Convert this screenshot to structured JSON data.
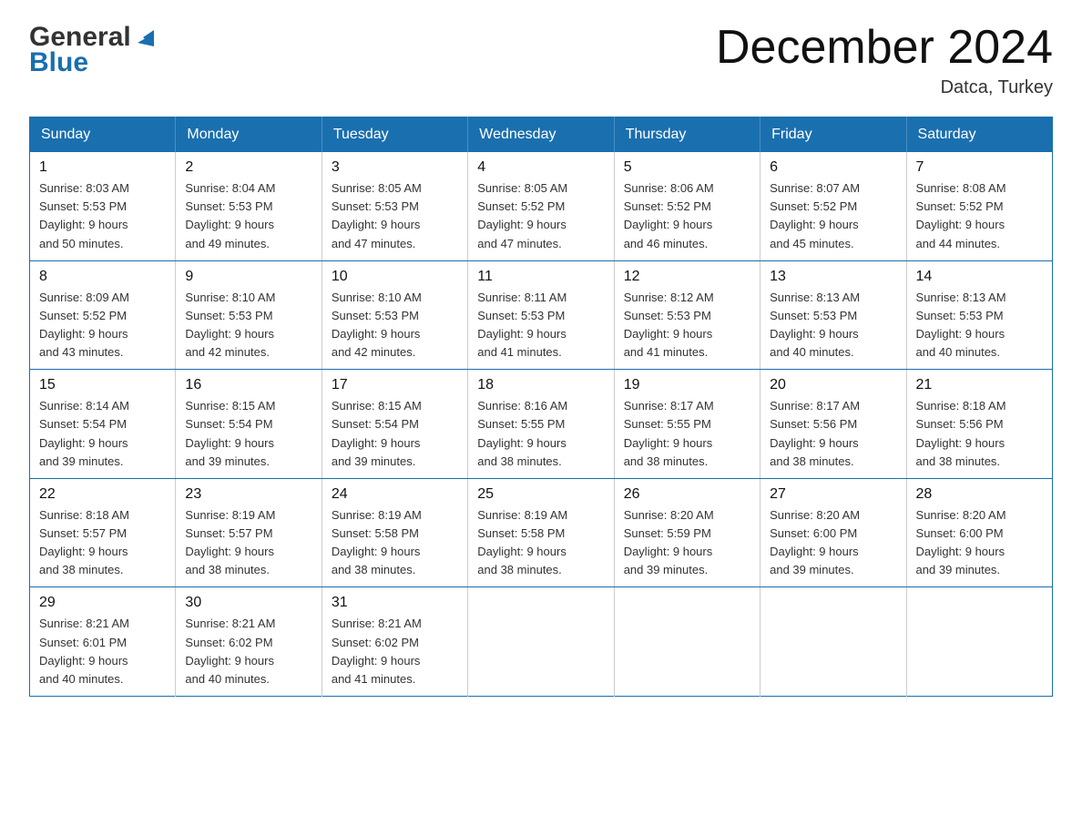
{
  "header": {
    "logo_general": "General",
    "logo_blue": "Blue",
    "title": "December 2024",
    "location": "Datca, Turkey"
  },
  "days_header": [
    "Sunday",
    "Monday",
    "Tuesday",
    "Wednesday",
    "Thursday",
    "Friday",
    "Saturday"
  ],
  "weeks": [
    [
      {
        "day": "1",
        "sunrise": "8:03 AM",
        "sunset": "5:53 PM",
        "daylight": "9 hours and 50 minutes."
      },
      {
        "day": "2",
        "sunrise": "8:04 AM",
        "sunset": "5:53 PM",
        "daylight": "9 hours and 49 minutes."
      },
      {
        "day": "3",
        "sunrise": "8:05 AM",
        "sunset": "5:53 PM",
        "daylight": "9 hours and 47 minutes."
      },
      {
        "day": "4",
        "sunrise": "8:05 AM",
        "sunset": "5:52 PM",
        "daylight": "9 hours and 47 minutes."
      },
      {
        "day": "5",
        "sunrise": "8:06 AM",
        "sunset": "5:52 PM",
        "daylight": "9 hours and 46 minutes."
      },
      {
        "day": "6",
        "sunrise": "8:07 AM",
        "sunset": "5:52 PM",
        "daylight": "9 hours and 45 minutes."
      },
      {
        "day": "7",
        "sunrise": "8:08 AM",
        "sunset": "5:52 PM",
        "daylight": "9 hours and 44 minutes."
      }
    ],
    [
      {
        "day": "8",
        "sunrise": "8:09 AM",
        "sunset": "5:52 PM",
        "daylight": "9 hours and 43 minutes."
      },
      {
        "day": "9",
        "sunrise": "8:10 AM",
        "sunset": "5:53 PM",
        "daylight": "9 hours and 42 minutes."
      },
      {
        "day": "10",
        "sunrise": "8:10 AM",
        "sunset": "5:53 PM",
        "daylight": "9 hours and 42 minutes."
      },
      {
        "day": "11",
        "sunrise": "8:11 AM",
        "sunset": "5:53 PM",
        "daylight": "9 hours and 41 minutes."
      },
      {
        "day": "12",
        "sunrise": "8:12 AM",
        "sunset": "5:53 PM",
        "daylight": "9 hours and 41 minutes."
      },
      {
        "day": "13",
        "sunrise": "8:13 AM",
        "sunset": "5:53 PM",
        "daylight": "9 hours and 40 minutes."
      },
      {
        "day": "14",
        "sunrise": "8:13 AM",
        "sunset": "5:53 PM",
        "daylight": "9 hours and 40 minutes."
      }
    ],
    [
      {
        "day": "15",
        "sunrise": "8:14 AM",
        "sunset": "5:54 PM",
        "daylight": "9 hours and 39 minutes."
      },
      {
        "day": "16",
        "sunrise": "8:15 AM",
        "sunset": "5:54 PM",
        "daylight": "9 hours and 39 minutes."
      },
      {
        "day": "17",
        "sunrise": "8:15 AM",
        "sunset": "5:54 PM",
        "daylight": "9 hours and 39 minutes."
      },
      {
        "day": "18",
        "sunrise": "8:16 AM",
        "sunset": "5:55 PM",
        "daylight": "9 hours and 38 minutes."
      },
      {
        "day": "19",
        "sunrise": "8:17 AM",
        "sunset": "5:55 PM",
        "daylight": "9 hours and 38 minutes."
      },
      {
        "day": "20",
        "sunrise": "8:17 AM",
        "sunset": "5:56 PM",
        "daylight": "9 hours and 38 minutes."
      },
      {
        "day": "21",
        "sunrise": "8:18 AM",
        "sunset": "5:56 PM",
        "daylight": "9 hours and 38 minutes."
      }
    ],
    [
      {
        "day": "22",
        "sunrise": "8:18 AM",
        "sunset": "5:57 PM",
        "daylight": "9 hours and 38 minutes."
      },
      {
        "day": "23",
        "sunrise": "8:19 AM",
        "sunset": "5:57 PM",
        "daylight": "9 hours and 38 minutes."
      },
      {
        "day": "24",
        "sunrise": "8:19 AM",
        "sunset": "5:58 PM",
        "daylight": "9 hours and 38 minutes."
      },
      {
        "day": "25",
        "sunrise": "8:19 AM",
        "sunset": "5:58 PM",
        "daylight": "9 hours and 38 minutes."
      },
      {
        "day": "26",
        "sunrise": "8:20 AM",
        "sunset": "5:59 PM",
        "daylight": "9 hours and 39 minutes."
      },
      {
        "day": "27",
        "sunrise": "8:20 AM",
        "sunset": "6:00 PM",
        "daylight": "9 hours and 39 minutes."
      },
      {
        "day": "28",
        "sunrise": "8:20 AM",
        "sunset": "6:00 PM",
        "daylight": "9 hours and 39 minutes."
      }
    ],
    [
      {
        "day": "29",
        "sunrise": "8:21 AM",
        "sunset": "6:01 PM",
        "daylight": "9 hours and 40 minutes."
      },
      {
        "day": "30",
        "sunrise": "8:21 AM",
        "sunset": "6:02 PM",
        "daylight": "9 hours and 40 minutes."
      },
      {
        "day": "31",
        "sunrise": "8:21 AM",
        "sunset": "6:02 PM",
        "daylight": "9 hours and 41 minutes."
      },
      null,
      null,
      null,
      null
    ]
  ],
  "labels": {
    "sunrise": "Sunrise:",
    "sunset": "Sunset:",
    "daylight": "Daylight:"
  },
  "colors": {
    "header_bg": "#1a6faf",
    "header_text": "#ffffff",
    "border": "#1a6faf",
    "cell_border": "#cccccc"
  }
}
